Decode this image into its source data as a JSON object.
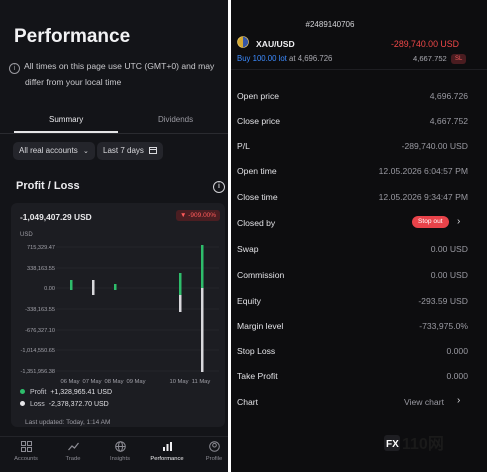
{
  "left": {
    "title": "Performance",
    "info_line1": "All times on this page use UTC (GMT+0) and may",
    "info_line2": "differ from your local time",
    "tabs": [
      {
        "label": "Summary",
        "active": true
      },
      {
        "label": "Dividends",
        "active": false
      }
    ],
    "filters": {
      "account": "All real accounts",
      "period": "Last 7 days"
    },
    "section_title": "Profit / Loss",
    "pl_value": "-1,049,407.29 USD",
    "pl_badge": "-909.00%",
    "y_unit": "USD",
    "chart_data": {
      "type": "bar",
      "ylabel": "USD",
      "y_ticks": [
        "715,329.47",
        "338,163.55",
        "0.00",
        "-338,163.55",
        "-676,327.10",
        "-1,014,550.65",
        "-1,351,956.38"
      ],
      "categories": [
        "06 May",
        "07 May",
        "08 May",
        "09 May",
        "10 May",
        "11 May"
      ],
      "series": [
        {
          "name": "Profit",
          "color": "#2ebd6b"
        },
        {
          "name": "Loss",
          "color": "#d8d8dc"
        }
      ]
    },
    "legend": [
      {
        "label": "Profit",
        "value": "+1,328,965.41 USD",
        "color": "#2ebd6b"
      },
      {
        "label": "Loss",
        "value": "-2,378,372.70 USD",
        "color": "#e5e5e8"
      }
    ],
    "last_updated": "Last updated: Today, 1:14 AM",
    "nav": [
      {
        "label": "Accounts",
        "icon": "accounts-grid-icon",
        "active": false
      },
      {
        "label": "Trade",
        "icon": "trade-chart-icon",
        "active": false
      },
      {
        "label": "Insights",
        "icon": "globe-icon",
        "active": false
      },
      {
        "label": "Performance",
        "icon": "bar-chart-icon",
        "active": true
      },
      {
        "label": "Profile",
        "icon": "profile-icon",
        "active": false
      }
    ]
  },
  "right": {
    "order_id": "#2489140706",
    "symbol": "XAU/USD",
    "pnl": "-289,740.00 USD",
    "buy_prefix": "Buy 100.00 lot",
    "buy_suffix": "at 4,696.726",
    "current_price": "4,667.752",
    "sl_tag": "SL",
    "rows": [
      {
        "label": "Open price",
        "value": "4,696.726"
      },
      {
        "label": "Close price",
        "value": "4,667.752"
      },
      {
        "label": "P/L",
        "value": "-289,740.00 USD"
      },
      {
        "label": "Open time",
        "value": "12.05.2026 6:04:57 PM"
      },
      {
        "label": "Close time",
        "value": "12.05.2026 9:34:47 PM"
      },
      {
        "label": "Closed by",
        "value": ""
      },
      {
        "label": "Swap",
        "value": "0.00 USD"
      },
      {
        "label": "Commission",
        "value": "0.00 USD"
      },
      {
        "label": "Equity",
        "value": "-293.59 USD"
      },
      {
        "label": "Margin level",
        "value": "-733,975.0%"
      },
      {
        "label": "Stop Loss",
        "value": "0.000"
      },
      {
        "label": "Take Profit",
        "value": "0.000"
      },
      {
        "label": "Chart",
        "value": ""
      }
    ],
    "closed_by_badge": "Stop out",
    "view_chart": "View chart",
    "brand": {
      "prefix": "FX",
      "suffix": "110网"
    }
  },
  "colors": {
    "accent_green": "#2ebd6b",
    "negative_red": "#f04848",
    "link_blue": "#3d8bff"
  }
}
